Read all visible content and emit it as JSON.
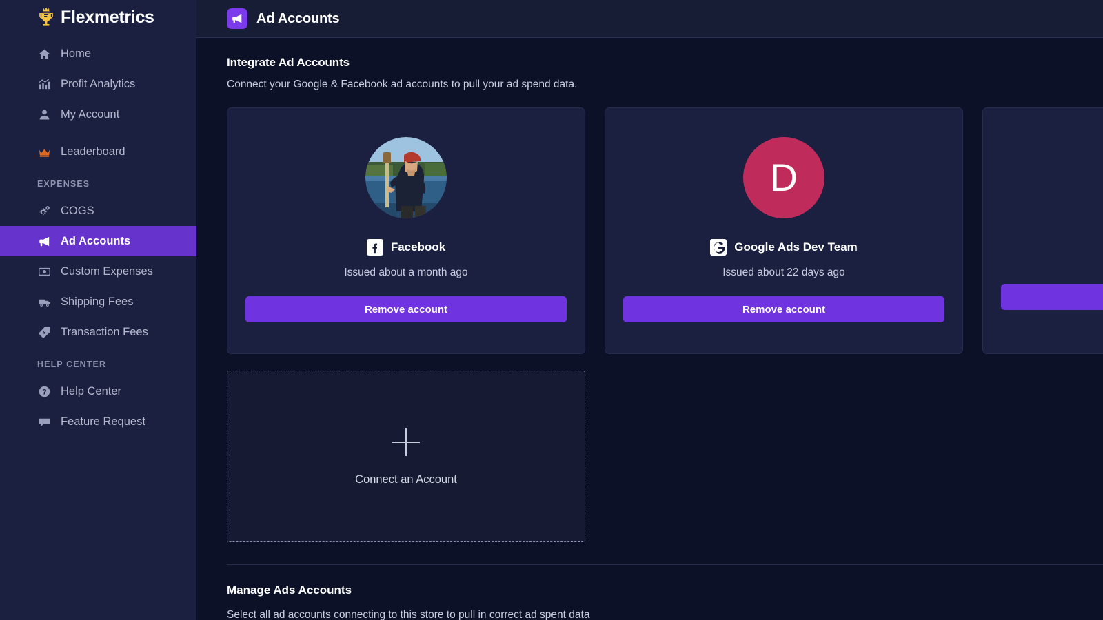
{
  "brand": {
    "name": "Flexmetrics",
    "logo_icon": "trophy-crown-icon"
  },
  "sidebar": {
    "items": [
      {
        "label": "Home",
        "icon": "home-icon",
        "active": false
      },
      {
        "label": "Profit Analytics",
        "icon": "chart-analytics-icon",
        "active": false
      },
      {
        "label": "My Account",
        "icon": "person-icon",
        "active": false
      },
      {
        "label": "Leaderboard",
        "icon": "crown-icon",
        "active": false
      }
    ],
    "expenses_label": "EXPENSES",
    "expenses_items": [
      {
        "label": "COGS",
        "icon": "gears-icon",
        "active": false
      },
      {
        "label": "Ad Accounts",
        "icon": "megaphone-icon",
        "active": true
      },
      {
        "label": "Custom Expenses",
        "icon": "money-bill-icon",
        "active": false
      },
      {
        "label": "Shipping Fees",
        "icon": "truck-icon",
        "active": false
      },
      {
        "label": "Transaction Fees",
        "icon": "price-tag-icon",
        "active": false
      }
    ],
    "help_label": "HELP CENTER",
    "help_items": [
      {
        "label": "Help Center",
        "icon": "question-circle-icon",
        "active": false
      },
      {
        "label": "Feature Request",
        "icon": "comment-icon",
        "active": false
      }
    ]
  },
  "topbar": {
    "title": "Ad Accounts",
    "icon": "megaphone-icon"
  },
  "integrate": {
    "title": "Integrate Ad Accounts",
    "subtitle": "Connect your Google & Facebook ad accounts to pull your ad spend data."
  },
  "accounts": [
    {
      "name": "Facebook",
      "issued": "Issued about a month ago",
      "platform_icon": "facebook-icon",
      "avatar_type": "photo",
      "avatar_letter": "",
      "avatar_color": "#8fb5d8",
      "button_label": "Remove account"
    },
    {
      "name": "Google Ads Dev Team",
      "issued": "Issued about 22 days ago",
      "platform_icon": "google-icon",
      "avatar_type": "letter",
      "avatar_letter": "D",
      "avatar_color": "#bf2c5b",
      "button_label": "Remove account"
    },
    {
      "name": "",
      "issued": "",
      "platform_icon": "google-icon",
      "avatar_type": "none",
      "avatar_letter": "",
      "avatar_color": "#1b2040",
      "button_label": ""
    }
  ],
  "connect_card": {
    "label": "Connect an Account",
    "icon": "plus-icon"
  },
  "manage": {
    "title": "Manage Ads Accounts",
    "subtitle": "Select all ad accounts connecting to this store to pull in correct ad spent data"
  },
  "colors": {
    "accent_purple": "#6633cc",
    "button_purple": "#7033e0",
    "sidebar_bg": "#1b2040",
    "main_bg": "#0c1128",
    "card_bg": "#1b2040",
    "brand_gold": "#f5c344"
  }
}
